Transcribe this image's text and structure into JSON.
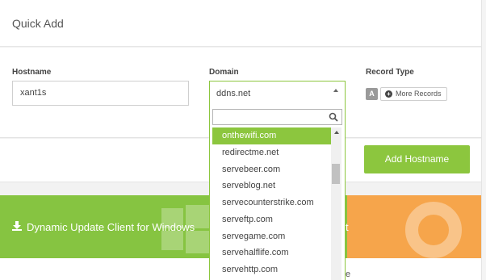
{
  "quick_add": {
    "title": "Quick Add",
    "hostname_label": "Hostname",
    "hostname_value": "xant1s",
    "domain_label": "Domain",
    "domain_value": "ddns.net",
    "record_type_label": "Record Type",
    "record_type_value": "A",
    "more_records_label": "More Records",
    "add_button_label": "Add Hostname"
  },
  "dropdown": {
    "search_value": "",
    "items": [
      {
        "label": "onthewifi.com",
        "highlighted": true
      },
      {
        "label": "redirectme.net",
        "highlighted": false
      },
      {
        "label": "servebeer.com",
        "highlighted": false
      },
      {
        "label": "serveblog.net",
        "highlighted": false
      },
      {
        "label": "servecounterstrike.com",
        "highlighted": false
      },
      {
        "label": "serveftp.com",
        "highlighted": false
      },
      {
        "label": "servegame.com",
        "highlighted": false
      },
      {
        "label": "servehalflife.com",
        "highlighted": false
      },
      {
        "label": "servehttp.com",
        "highlighted": false
      }
    ]
  },
  "banner": {
    "left_text": "Dynamic Update Client for Windows",
    "right_fragment": "t",
    "lower_fragment": "e"
  },
  "colors": {
    "accent_green": "#8cc63e",
    "banner_green": "#86c441",
    "banner_orange": "#f6a54b"
  },
  "icons": {
    "download": "download-icon",
    "windows": "windows-logo-icon",
    "lifebuoy": "lifebuoy-icon",
    "search": "search-icon",
    "plus": "plus-circle-icon"
  }
}
